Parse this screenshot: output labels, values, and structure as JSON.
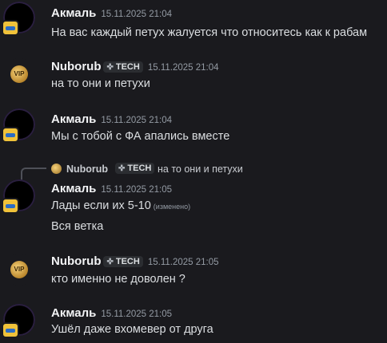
{
  "messages": [
    {
      "author": "Акмаль",
      "time": "15.11.2025 21:04",
      "text": "На вас каждый петух жалуется что относитесь как к рабам"
    },
    {
      "author": "Nuborub",
      "tag": "TECH",
      "time": "15.11.2025 21:04",
      "text": "на то они и петухи",
      "avatar_text": "VIP"
    },
    {
      "author": "Акмаль",
      "time": "15.11.2025 21:04",
      "text": "Мы с тобой с ФА апались вместе"
    },
    {
      "author": "Акмаль",
      "time": "15.11.2025 21:05",
      "text": "Лады если их 5-10",
      "edited": "(изменено)",
      "text2": "Вся ветка",
      "reply": {
        "author": "Nuborub",
        "tag": "TECH",
        "text": "на то они и петухи"
      }
    },
    {
      "author": "Nuborub",
      "tag": "TECH",
      "time": "15.11.2025 21:05",
      "text": "кто именно не доволен ?",
      "avatar_text": "VIP"
    },
    {
      "author": "Акмаль",
      "time": "15.11.2025 21:05",
      "text": "Ушёл даже вхомевер от друга"
    }
  ],
  "colors": {
    "background": "#1a1a1e",
    "name": "#f2f3f5",
    "text": "#dbdee1",
    "muted": "#949ba4"
  },
  "icons": {
    "tag_icon": "gem-icon",
    "avatar_badge": "badge-icon"
  }
}
